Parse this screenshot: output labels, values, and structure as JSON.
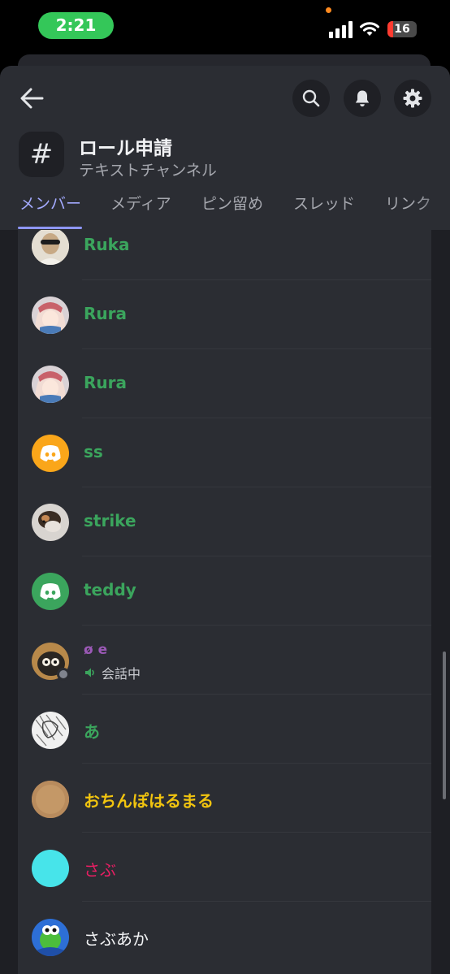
{
  "status_bar": {
    "time": "2:21",
    "battery": "16"
  },
  "channel": {
    "name": "ロール申請",
    "type": "テキストチャンネル",
    "icon": "#"
  },
  "tabs": [
    {
      "label": "メンバー",
      "active": true
    },
    {
      "label": "メディア"
    },
    {
      "label": "ピン留め"
    },
    {
      "label": "スレッド"
    },
    {
      "label": "リンク"
    }
  ],
  "members": [
    {
      "name": "Ruka",
      "color": "#3ba55d",
      "avatar": "photo-avatar"
    },
    {
      "name": "Rura",
      "color": "#3ba55d",
      "avatar": "anime-avatar"
    },
    {
      "name": "Rura",
      "color": "#3ba55d",
      "avatar": "anime-avatar"
    },
    {
      "name": "ss",
      "color": "#3ba55d",
      "avatar": "discord-default-orange"
    },
    {
      "name": "strike",
      "color": "#3ba55d",
      "avatar": "photo-avatar"
    },
    {
      "name": "teddy",
      "color": "#3ba55d",
      "avatar": "discord-default-green"
    },
    {
      "name": "ø e",
      "color": "#9b59b6",
      "avatar": "cat-avatar",
      "activity": "会話中"
    },
    {
      "name": "あ",
      "color": "#3ba55d",
      "avatar": "sketch-avatar"
    },
    {
      "name": "おちんぽはるまる",
      "color": "#f1c40f",
      "avatar": "tan-avatar"
    },
    {
      "name": "さぶ",
      "color": "#e91e63",
      "avatar": "cyan-avatar"
    },
    {
      "name": "さぶあか",
      "color": "#f2f3f5",
      "avatar": "yoshi-avatar"
    }
  ],
  "colors": {
    "accent": "#8e96ff",
    "background": "#2b2d33"
  }
}
